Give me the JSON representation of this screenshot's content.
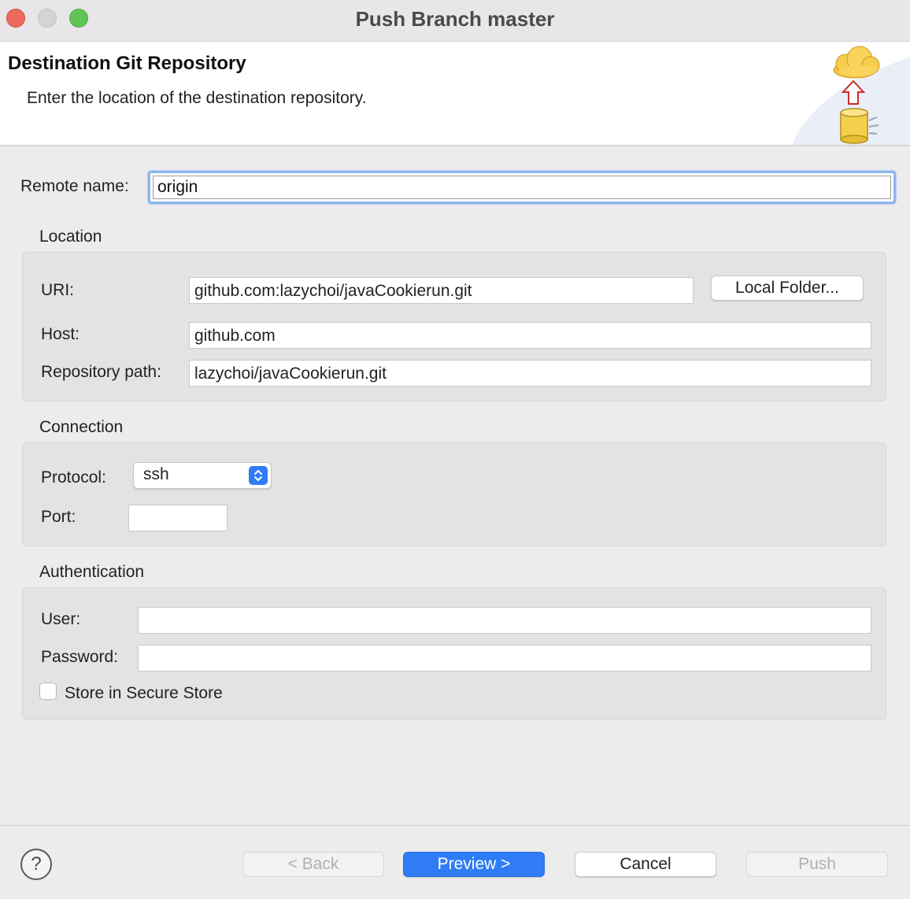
{
  "window": {
    "title": "Push Branch master"
  },
  "banner": {
    "title": "Destination Git Repository",
    "description": "Enter the location of the destination repository."
  },
  "remote": {
    "label": "Remote name:",
    "value": "origin"
  },
  "location": {
    "title": "Location",
    "uri_label": "URI:",
    "uri_value": "github.com:lazychoi/javaCookierun.git",
    "local_folder_button": "Local Folder...",
    "host_label": "Host:",
    "host_value": "github.com",
    "path_label": "Repository path:",
    "path_value": "lazychoi/javaCookierun.git"
  },
  "connection": {
    "title": "Connection",
    "protocol_label": "Protocol:",
    "protocol_value": "ssh",
    "port_label": "Port:",
    "port_value": ""
  },
  "authentication": {
    "title": "Authentication",
    "user_label": "User:",
    "user_value": "",
    "password_label": "Password:",
    "password_value": "",
    "store_label": "Store in Secure Store",
    "store_checked": false
  },
  "footer": {
    "help_symbol": "?",
    "back_label": "< Back",
    "preview_label": "Preview >",
    "cancel_label": "Cancel",
    "push_label": "Push"
  },
  "colors": {
    "accent": "#2f7cf6",
    "close": "#ed6a5e",
    "zoom": "#61c554",
    "focus_ring": "#8fb5ec"
  },
  "icons": [
    "cloud-icon",
    "upload-arrow-icon",
    "repository-cylinder-icon",
    "stepper-arrows-icon",
    "help-icon"
  ]
}
